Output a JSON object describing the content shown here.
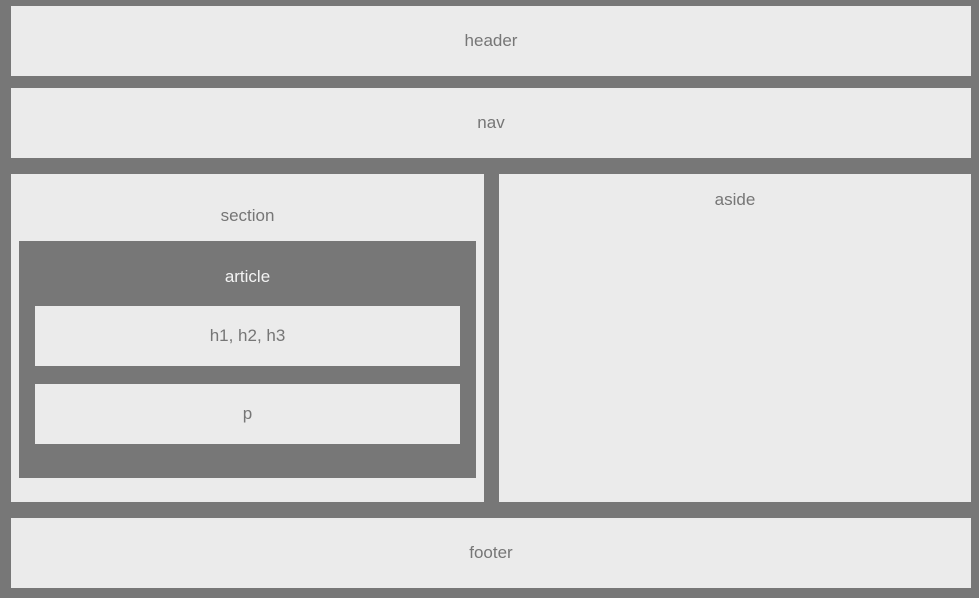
{
  "regions": {
    "header": "header",
    "nav": "nav",
    "section": "section",
    "article": "article",
    "headings": "h1, h2, h3",
    "paragraph": "p",
    "aside": "aside",
    "footer": "footer"
  },
  "colors": {
    "background": "#777777",
    "box": "#ebebeb",
    "text": "#767676",
    "article_text": "#f3f3f3"
  }
}
